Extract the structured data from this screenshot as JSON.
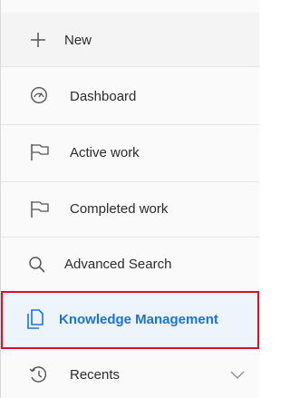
{
  "nav": {
    "items": [
      {
        "label": "New",
        "icon": "plus-icon"
      },
      {
        "label": "Dashboard",
        "icon": "gauge-icon"
      },
      {
        "label": "Active work",
        "icon": "flag-icon"
      },
      {
        "label": "Completed work",
        "icon": "flag-icon"
      },
      {
        "label": "Advanced Search",
        "icon": "search-icon"
      },
      {
        "label": "Knowledge Management",
        "icon": "documents-icon",
        "selected": true
      },
      {
        "label": "Recents",
        "icon": "history-icon",
        "expandable": true
      }
    ]
  },
  "colors": {
    "accent": "#1a73d9",
    "selection_outline": "#d9122a",
    "icon": "#555555"
  }
}
